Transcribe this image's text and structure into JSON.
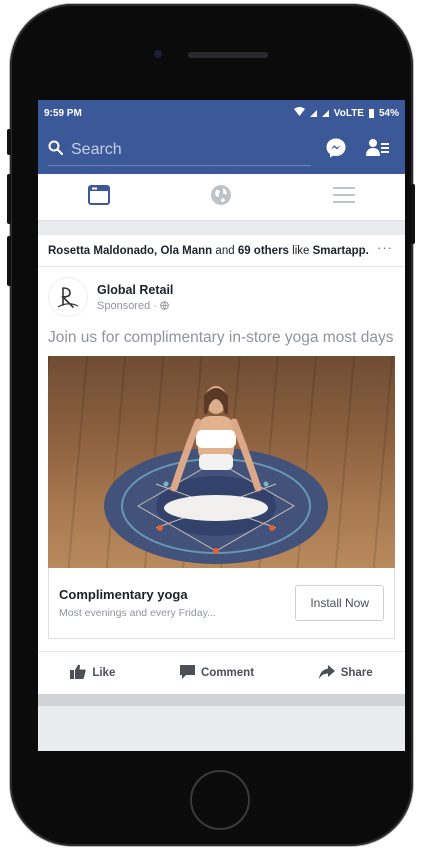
{
  "status_bar": {
    "time": "9:59 PM",
    "network": "VoLTE",
    "battery": "54%"
  },
  "search": {
    "placeholder": "Search"
  },
  "header_icons": [
    "search-icon",
    "messenger-icon",
    "friend-requests-icon"
  ],
  "tabs": [
    {
      "name": "news-feed",
      "icon": "news-feed-icon",
      "active": true
    },
    {
      "name": "notifications",
      "icon": "globe-icon",
      "active": false
    },
    {
      "name": "menu",
      "icon": "menu-icon",
      "active": false
    }
  ],
  "post": {
    "social_context": {
      "friends": "Rosetta Maldonado, Ola Mann",
      "and": "and",
      "others": "69 others",
      "like": "like",
      "app": "Smartapp."
    },
    "more_label": "···",
    "page_name": "Global Retail",
    "sponsored_label": "Sponsored",
    "text": "Join us for complimentary in-store yoga most days",
    "cta": {
      "title": "Complimentary yoga",
      "subtitle": "Most evenings and every Friday...",
      "button_label": "Install Now"
    },
    "actions": {
      "like": "Like",
      "comment": "Comment",
      "share": "Share"
    }
  },
  "colors": {
    "brand": "#3b5998",
    "feed_background": "#e9ebee"
  }
}
